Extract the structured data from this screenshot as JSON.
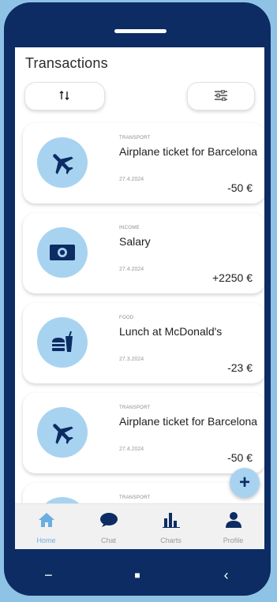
{
  "header": {
    "title": "Transactions"
  },
  "toolbar": {
    "sort_icon": "sort-arrows-icon",
    "filter_icon": "sliders-icon"
  },
  "transactions": [
    {
      "category": "TRANSPORT",
      "name": "Airplane ticket for Barcelona",
      "date": "27.4.2024",
      "amount": "-50 €",
      "icon": "airplane-icon"
    },
    {
      "category": "INCOME",
      "name": "Salary",
      "date": "27.4.2024",
      "amount": "+2250 €",
      "icon": "banknote-icon"
    },
    {
      "category": "FOOD",
      "name": "Lunch at McDonald's",
      "date": "27.3.2024",
      "amount": "-23 €",
      "icon": "fast-food-icon"
    },
    {
      "category": "TRANSPORT",
      "name": "Airplane ticket for Barcelona",
      "date": "27.4.2024",
      "amount": "-50 €",
      "icon": "airplane-icon"
    },
    {
      "category": "TRANSPORT",
      "name": "",
      "date": "",
      "amount": "",
      "icon": "airplane-icon"
    }
  ],
  "fab": {
    "label": "+"
  },
  "tabs": [
    {
      "label": "Home",
      "icon": "home-icon",
      "active": true
    },
    {
      "label": "Chat",
      "icon": "chat-bubble-icon",
      "active": false
    },
    {
      "label": "Charts",
      "icon": "bar-chart-icon",
      "active": false
    },
    {
      "label": "Profile",
      "icon": "person-icon",
      "active": false
    }
  ],
  "system_nav": {
    "recents": "−",
    "home": "■",
    "back": "‹"
  },
  "colors": {
    "frame": "#0c2c63",
    "accent": "#a8d3f0",
    "active_tab": "#6aaee0",
    "background": "#8fc3e6"
  }
}
